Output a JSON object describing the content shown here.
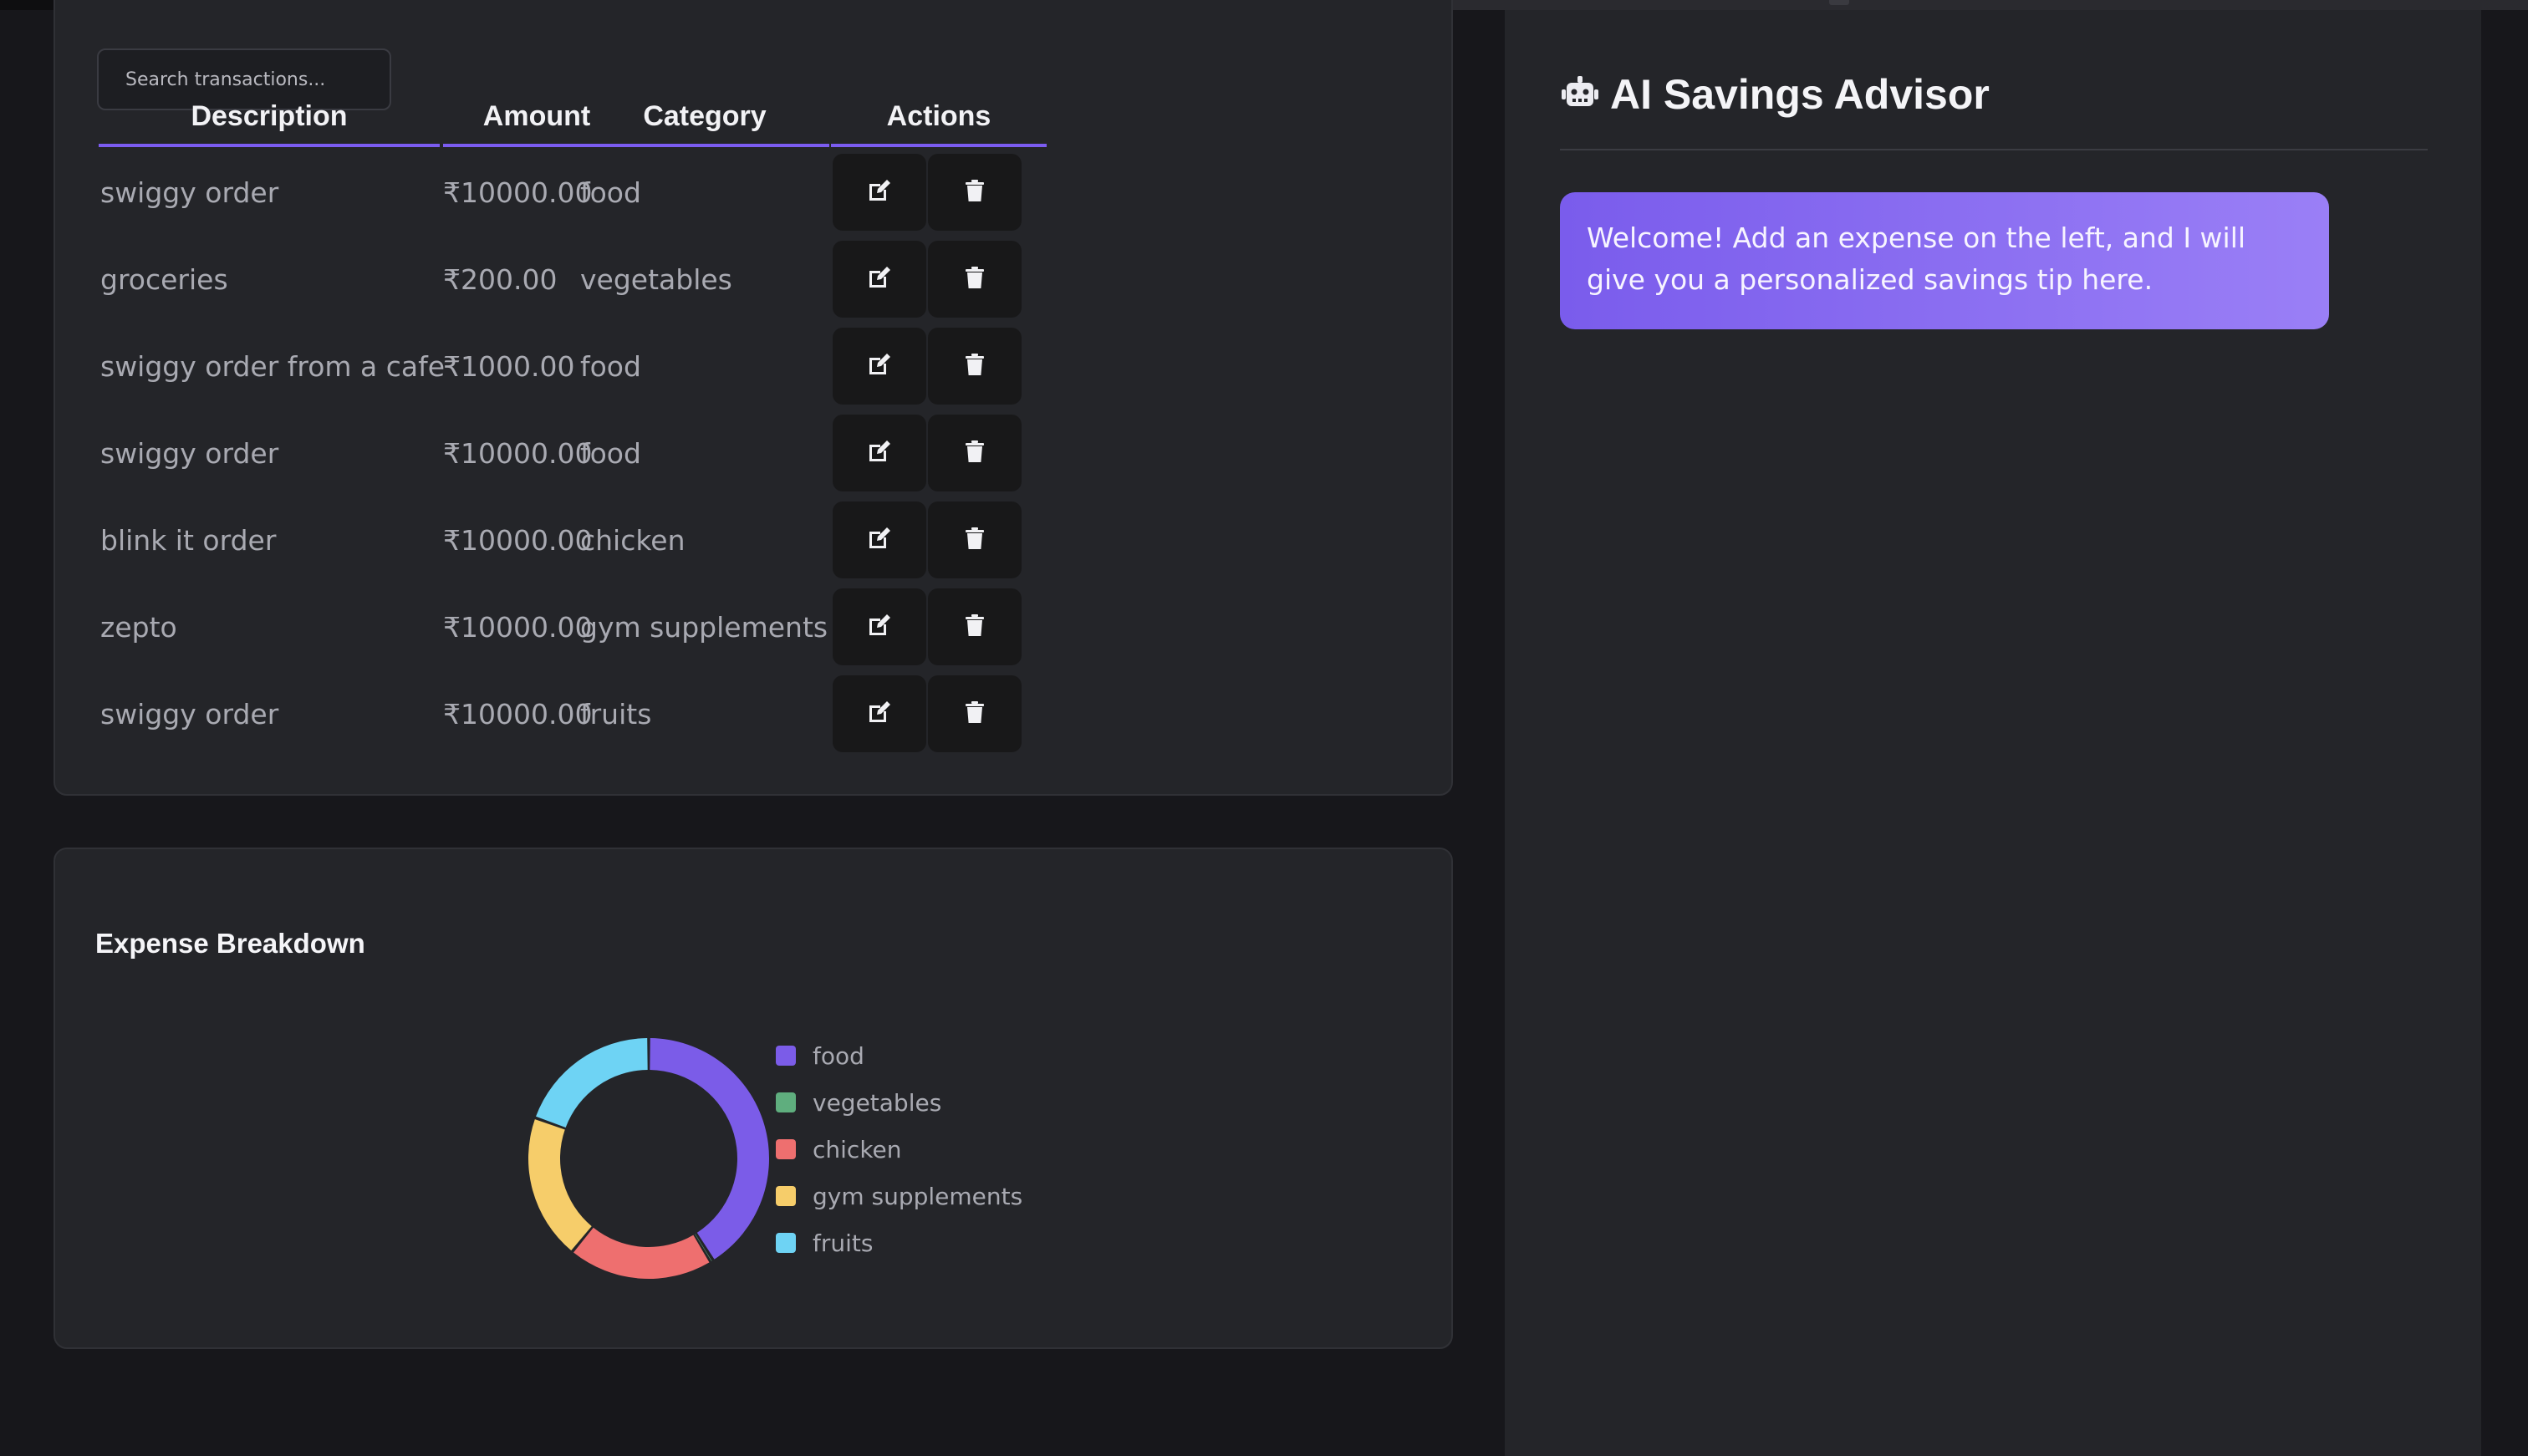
{
  "transactions": {
    "search_placeholder": "Search transactions...",
    "headers": {
      "description": "Description",
      "amount": "Amount",
      "category": "Category",
      "actions": "Actions"
    },
    "rows": [
      {
        "description": "swiggy order",
        "amount": "₹10000.00",
        "category": "food"
      },
      {
        "description": "groceries",
        "amount": "₹200.00",
        "category": "vegetables"
      },
      {
        "description": "swiggy order from a cafe",
        "amount": "₹1000.00",
        "category": "food"
      },
      {
        "description": "swiggy order",
        "amount": "₹10000.00",
        "category": "food"
      },
      {
        "description": "blink it order",
        "amount": "₹10000.00",
        "category": "chicken"
      },
      {
        "description": "zepto",
        "amount": "₹10000.00",
        "category": "gym supplements"
      },
      {
        "description": "swiggy order",
        "amount": "₹10000.00",
        "category": "fruits"
      }
    ]
  },
  "breakdown": {
    "title": "Expense Breakdown"
  },
  "chart_data": {
    "type": "pie",
    "style": "doughnut",
    "categories": [
      "food",
      "vegetables",
      "chicken",
      "gym supplements",
      "fruits"
    ],
    "values": [
      21000,
      200,
      10000,
      10000,
      10000
    ],
    "colors": [
      "#7b5ce8",
      "#5fae7e",
      "#ee6f6f",
      "#f6cd6a",
      "#6ed3f4"
    ],
    "legend": "right"
  },
  "advisor": {
    "title": "AI Savings Advisor",
    "icon": "robot-icon",
    "message": "Welcome! Add an expense on the left, and I will give you a personalized savings tip here."
  },
  "colors": {
    "accent": "#7b5cf0",
    "card_bg": "#242529",
    "page_bg": "#17171b"
  }
}
